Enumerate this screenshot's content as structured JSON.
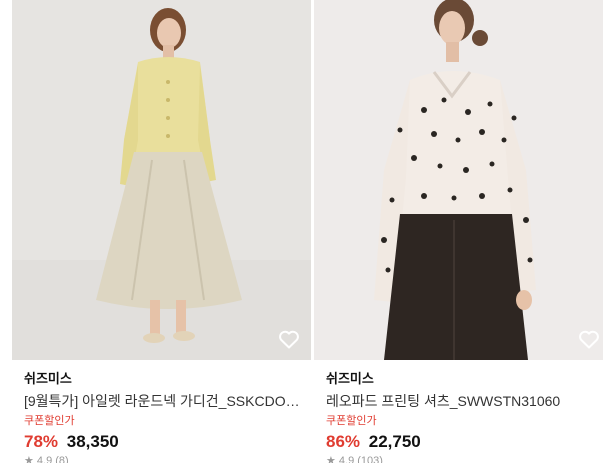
{
  "products": [
    {
      "brand": "쉬즈미스",
      "title": "[9월특가] 아일렛 라운드넥 가디건_SSKCDO…",
      "coupon": "쿠폰할인가",
      "discount": "78%",
      "price": "38,350",
      "rating": "★ 4.9 (8)",
      "wishlist_icon": "heart-outline-icon"
    },
    {
      "brand": "쉬즈미스",
      "title": "레오파드 프린팅 셔츠_SWWSTN31060",
      "coupon": "쿠폰할인가",
      "discount": "86%",
      "price": "22,750",
      "rating": "★ 4.9 (103)",
      "wishlist_icon": "heart-outline-icon"
    }
  ],
  "colors": {
    "discount": "#e03c31",
    "text": "#111111",
    "muted": "#999999"
  }
}
